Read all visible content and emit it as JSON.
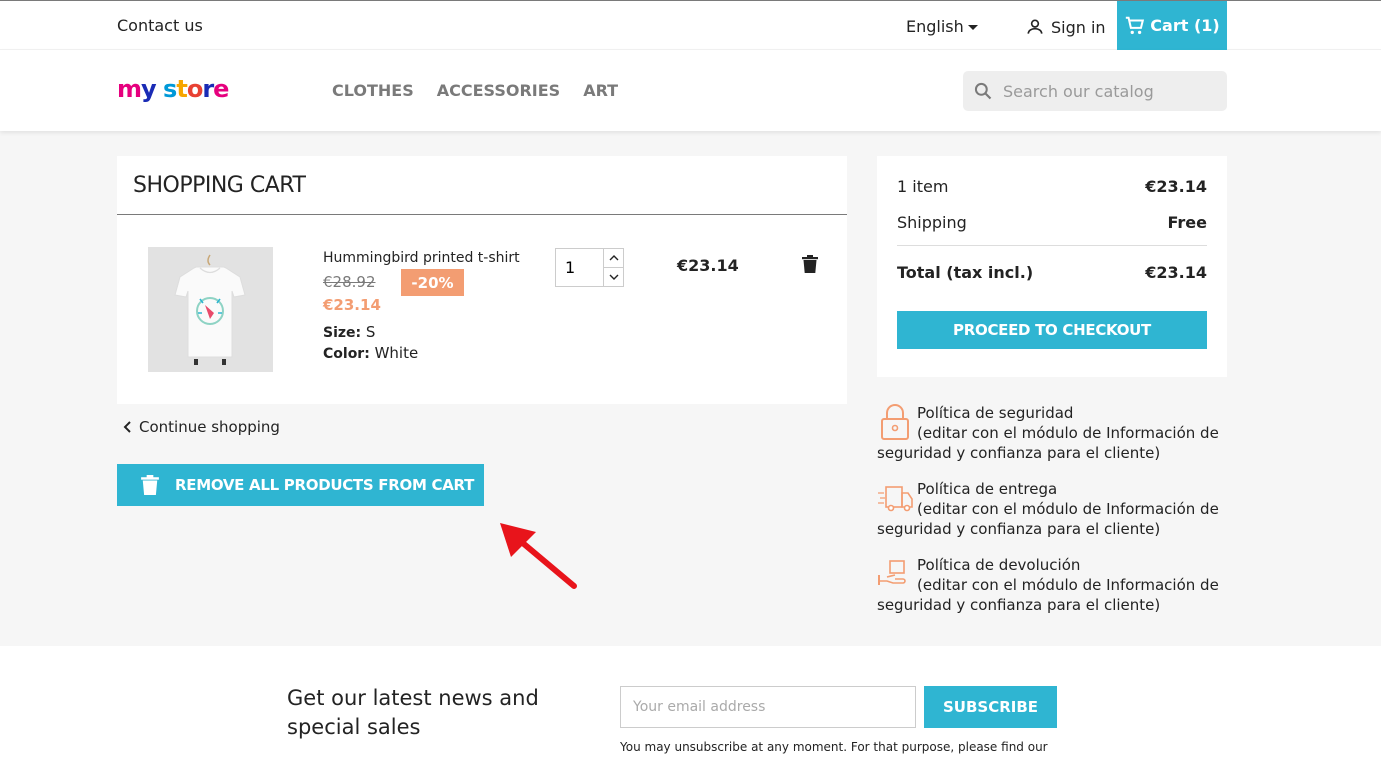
{
  "topbar": {
    "contact": "Contact us",
    "language": "English",
    "sign_in": "Sign in",
    "cart": "Cart (1)"
  },
  "header": {
    "logo_text": "my store",
    "nav": [
      "CLOTHES",
      "ACCESSORIES",
      "ART"
    ],
    "search_placeholder": "Search our catalog"
  },
  "cart": {
    "title": "SHOPPING CART",
    "item": {
      "name": "Hummingbird printed t-shirt",
      "old_price": "€28.92",
      "discount": "-20%",
      "price": "€23.14",
      "size_label": "Size:",
      "size_value": "S",
      "color_label": "Color:",
      "color_value": "White",
      "quantity": "1",
      "line_total": "€23.14"
    },
    "continue_shopping": "Continue shopping",
    "remove_all": "REMOVE ALL PRODUCTS FROM CART"
  },
  "summary": {
    "items_label": "1 item",
    "items_value": "€23.14",
    "shipping_label": "Shipping",
    "shipping_value": "Free",
    "total_label": "Total (tax incl.)",
    "total_value": "€23.14",
    "checkout": "PROCEED TO CHECKOUT"
  },
  "reassurance": [
    {
      "title": "Política de seguridad",
      "desc": "(editar con el módulo de Información de seguridad y confianza para el cliente)",
      "icon": "lock-icon"
    },
    {
      "title": "Política de entrega",
      "desc": "(editar con el módulo de Información de seguridad y confianza para el cliente)",
      "icon": "delivery-truck-icon"
    },
    {
      "title": "Política de devolución",
      "desc": "(editar con el módulo de Información de seguridad y confianza para el cliente)",
      "icon": "return-hand-icon"
    }
  ],
  "newsletter": {
    "title": "Get our latest news and special sales",
    "placeholder": "Your email address",
    "button": "SUBSCRIBE",
    "note": "You may unsubscribe at any moment. For that purpose, please find our"
  },
  "colors": {
    "accent": "#2fb5d2",
    "discount": "#f39d72",
    "annotation_arrow": "#e8141b"
  }
}
